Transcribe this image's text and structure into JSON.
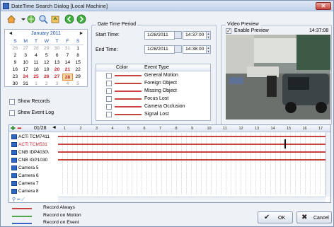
{
  "window": {
    "title": "DateTime Search Dialog  [Local Machine]",
    "close_glyph": "✕"
  },
  "toolbar": {
    "icons": [
      "home-icon",
      "network-icon",
      "search-icon",
      "export-icon",
      "back-icon",
      "forward-icon"
    ]
  },
  "calendar": {
    "month_label": "January 2011",
    "prev": "◄",
    "next": "►",
    "weekdays": [
      "S",
      "M",
      "T",
      "W",
      "T",
      "F",
      "S"
    ],
    "weeks": [
      [
        "26",
        "27",
        "28",
        "29",
        "30",
        "31",
        "1"
      ],
      [
        "2",
        "3",
        "4",
        "5",
        "6",
        "7",
        "8"
      ],
      [
        "9",
        "10",
        "11",
        "12",
        "13",
        "14",
        "15"
      ],
      [
        "16",
        "17",
        "18",
        "19",
        "20",
        "21",
        "22"
      ],
      [
        "23",
        "24",
        "25",
        "26",
        "27",
        "28",
        "29"
      ],
      [
        "30",
        "31",
        "1",
        "2",
        "3",
        "4",
        "5"
      ]
    ]
  },
  "options": {
    "show_records": "Show Records",
    "show_event_log": "Show Event Log"
  },
  "period": {
    "title": "Date Time Period",
    "start_label": "Start Time:",
    "start_date": "1/28/2011",
    "start_time": "14:37:00",
    "end_label": "End Time:",
    "end_date": "1/28/2011",
    "end_time": "14:38:00"
  },
  "events": {
    "col_color": "Color",
    "col_type": "Event Type",
    "rows": [
      "General Motion",
      "Foreign Object",
      "Missing Object",
      "Focus Lost",
      "Camera Occlusion",
      "Signal Lost"
    ],
    "line_color": "#c8433d"
  },
  "preview": {
    "title": "Video Preview",
    "enable_label": "Enable Preview",
    "time": "14:37:08"
  },
  "timeline": {
    "date": "01/28",
    "ticks": [
      "1",
      "2",
      "3",
      "4",
      "5",
      "6",
      "7",
      "8",
      "9",
      "10",
      "11",
      "12",
      "13",
      "14",
      "15",
      "16",
      "17"
    ],
    "cameras": [
      "ACTi TCM7411",
      "ACTi TCM531",
      "CNB IDP4030\\",
      "CNB IGP1030",
      "Camera 5",
      "Camera 6",
      "Camera 7",
      "Camera 8"
    ]
  },
  "legend": {
    "always": {
      "label": "Record Always",
      "color": "#c8433d"
    },
    "motion": {
      "label": "Record on Motion",
      "color": "#4fa64a"
    },
    "event": {
      "label": "Record on Event",
      "color": "#3666c2"
    }
  },
  "buttons": {
    "ok": "OK",
    "cancel": "Cancel"
  }
}
